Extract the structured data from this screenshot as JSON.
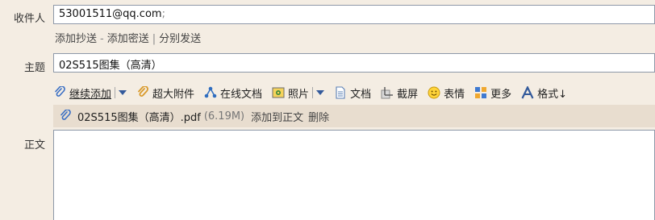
{
  "recipient": {
    "label": "收件人",
    "value": "53001511@qq.com",
    "trailing": ";"
  },
  "recipient_links": {
    "add_cc": "添加抄送",
    "dash": "-",
    "add_bcc": "添加密送",
    "bar": "|",
    "send_separately": "分别发送"
  },
  "subject": {
    "label": "主题",
    "value": "02S515图集（高清）"
  },
  "toolbar": {
    "continue_add": "继续添加",
    "large_attachment": "超大附件",
    "online_docs": "在线文档",
    "photo": "照片",
    "document": "文档",
    "screenshot": "截屏",
    "emoji": "表情",
    "more": "更多",
    "format": "格式↓"
  },
  "attachment": {
    "name": "02S515图集（高清）.pdf",
    "size": "(6.19M)",
    "add_to_body": "添加到正文",
    "delete": "删除"
  },
  "body": {
    "label": "正文",
    "content": ""
  },
  "icons": {
    "paperclip": "paperclip-icon",
    "large_attachment": "large-attachment-icon",
    "online_docs": "share-nodes-icon",
    "photo": "photo-icon",
    "document": "document-icon",
    "screenshot": "screenshot-icon",
    "emoji": "smiley-icon",
    "more": "grid-icon",
    "format": "font-a-icon"
  },
  "colors": {
    "background": "#f4ede3",
    "attachment_bar": "#e8ddcf",
    "field_border": "#8d98a8",
    "link_blue": "#335a9b"
  }
}
